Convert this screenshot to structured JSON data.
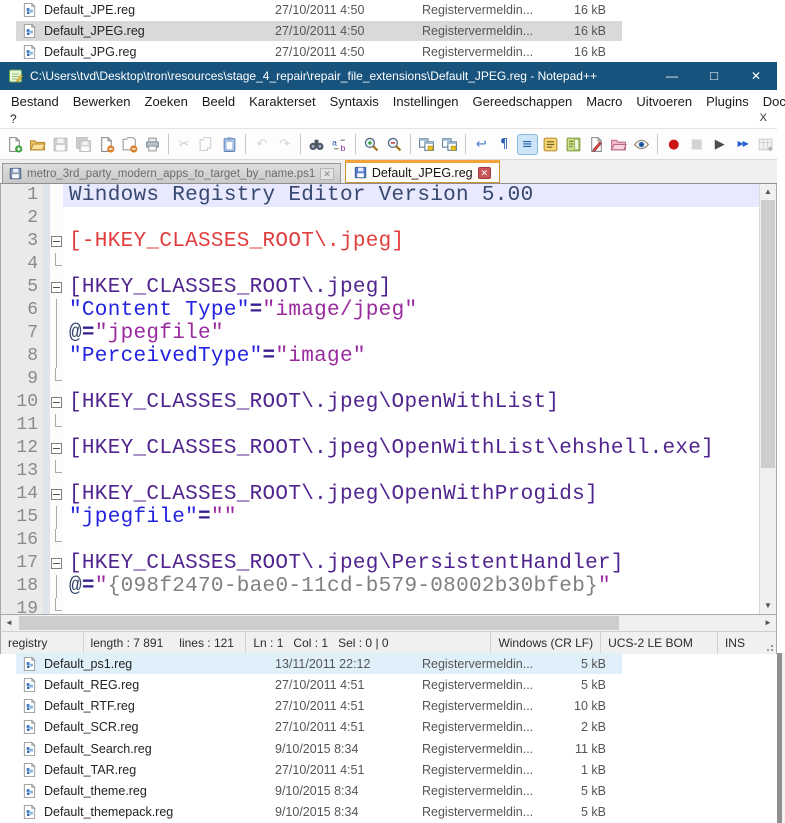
{
  "colors": {
    "titlebar": "#17537c",
    "tab_accent": "#f2a33c",
    "selection_gray": "#d9d9d9",
    "hover_blue": "#e0f0fa",
    "current_line": "#e8e8ff"
  },
  "explorer_top": {
    "rows": [
      {
        "name": "Default_JPE.reg",
        "date": "27/10/2011 4:50",
        "type": "Registervermeldin...",
        "size": "16 kB",
        "state": ""
      },
      {
        "name": "Default_JPEG.reg",
        "date": "27/10/2011 4:50",
        "type": "Registervermeldin...",
        "size": "16 kB",
        "state": "selected"
      },
      {
        "name": "Default_JPG.reg",
        "date": "27/10/2011 4:50",
        "type": "Registervermeldin...",
        "size": "16 kB",
        "state": ""
      }
    ]
  },
  "explorer_bottom": {
    "rows": [
      {
        "name": "Default_ps1.reg",
        "date": "13/11/2011 22:12",
        "type": "Registervermeldin...",
        "size": "5 kB",
        "state": "hover"
      },
      {
        "name": "Default_REG.reg",
        "date": "27/10/2011 4:51",
        "type": "Registervermeldin...",
        "size": "5 kB",
        "state": ""
      },
      {
        "name": "Default_RTF.reg",
        "date": "27/10/2011 4:51",
        "type": "Registervermeldin...",
        "size": "10 kB",
        "state": ""
      },
      {
        "name": "Default_SCR.reg",
        "date": "27/10/2011 4:51",
        "type": "Registervermeldin...",
        "size": "2 kB",
        "state": ""
      },
      {
        "name": "Default_Search.reg",
        "date": "9/10/2015 8:34",
        "type": "Registervermeldin...",
        "size": "11 kB",
        "state": ""
      },
      {
        "name": "Default_TAR.reg",
        "date": "27/10/2011 4:51",
        "type": "Registervermeldin...",
        "size": "1 kB",
        "state": ""
      },
      {
        "name": "Default_theme.reg",
        "date": "9/10/2015 8:34",
        "type": "Registervermeldin...",
        "size": "5 kB",
        "state": ""
      },
      {
        "name": "Default_themepack.reg",
        "date": "9/10/2015 8:34",
        "type": "Registervermeldin...",
        "size": "5 kB",
        "state": ""
      }
    ]
  },
  "npp": {
    "title": "C:\\Users\\tvd\\Desktop\\tron\\resources\\stage_4_repair\\repair_file_extensions\\Default_JPEG.reg - Notepad++",
    "window_controls": {
      "minimize": "—",
      "maximize": "□",
      "close": "✕"
    },
    "menus": [
      "Bestand",
      "Bewerken",
      "Zoeken",
      "Beeld",
      "Karakterset",
      "Syntaxis",
      "Instellingen",
      "Gereedschappen",
      "Macro",
      "Uitvoeren",
      "Plugins",
      "Documenten"
    ],
    "menu_overflow": "?",
    "menu_close_x": "X",
    "toolbar": [
      {
        "name": "new-file",
        "kind": "pagePlus"
      },
      {
        "name": "open-file",
        "kind": "folderOpen"
      },
      {
        "name": "save",
        "kind": "floppy",
        "disabled": true
      },
      {
        "name": "save-all",
        "kind": "floppy2",
        "disabled": true
      },
      {
        "name": "close",
        "kind": "pageMinus"
      },
      {
        "name": "close-all",
        "kind": "pagesMinus"
      },
      {
        "name": "print",
        "kind": "printer"
      },
      {
        "sep": true
      },
      {
        "name": "cut",
        "kind": "char",
        "glyph": "✂",
        "color": "#8a8a8a",
        "disabled": true
      },
      {
        "name": "copy",
        "kind": "pages",
        "disabled": true
      },
      {
        "name": "paste",
        "kind": "clipboard"
      },
      {
        "sep": true
      },
      {
        "name": "undo",
        "kind": "char",
        "glyph": "↶",
        "color": "#9a9a9a",
        "disabled": true
      },
      {
        "name": "redo",
        "kind": "char",
        "glyph": "↷",
        "color": "#9a9a9a",
        "disabled": true
      },
      {
        "sep": true
      },
      {
        "name": "find",
        "kind": "binoculars"
      },
      {
        "name": "replace",
        "kind": "replace",
        "glyph": "ab"
      },
      {
        "sep": true
      },
      {
        "name": "zoom-in",
        "kind": "magPlus"
      },
      {
        "name": "zoom-out",
        "kind": "magMinus"
      },
      {
        "sep": true
      },
      {
        "name": "sync-vertical-scroll",
        "kind": "winpair"
      },
      {
        "name": "sync-horizontal-scroll",
        "kind": "winpair"
      },
      {
        "sep": true
      },
      {
        "name": "word-wrap",
        "kind": "char",
        "glyph": "↩",
        "color": "#4a79c9"
      },
      {
        "name": "show-all-characters",
        "kind": "char",
        "glyph": "¶",
        "color": "#2a5db0"
      },
      {
        "name": "show-indent-guide",
        "kind": "char",
        "glyph": "≡",
        "color": "#2a5db0",
        "active": true
      },
      {
        "name": "function-list",
        "kind": "funclist"
      },
      {
        "name": "document-map",
        "kind": "docmap"
      },
      {
        "name": "document-switcher",
        "kind": "docswitch"
      },
      {
        "name": "folder-as-workspace",
        "kind": "folderPink"
      },
      {
        "name": "monitoring",
        "kind": "eye"
      },
      {
        "sep": true
      },
      {
        "name": "record-macro",
        "kind": "char",
        "glyph": "●",
        "color": "#cc1616"
      },
      {
        "name": "stop-macro",
        "kind": "char",
        "glyph": "■",
        "color": "#9a9a9a",
        "disabled": true
      },
      {
        "name": "play-macro",
        "kind": "char",
        "glyph": "▶",
        "color": "#4d4d4d"
      },
      {
        "name": "run-macro-multiple",
        "kind": "ffwd",
        "glyph": "▶▶",
        "color": "#2a5fd0"
      },
      {
        "name": "save-macro",
        "kind": "macrosave",
        "disabled": true
      }
    ],
    "tabs": [
      {
        "label": "metro_3rd_party_modern_apps_to_target_by_name.ps1",
        "close": "✕",
        "active": false
      },
      {
        "label": "Default_JPEG.reg",
        "close": "✕",
        "active": true
      }
    ],
    "editor": {
      "lines": [
        {
          "n": "1",
          "fold": "",
          "cur": true,
          "t": [
            [
              "Windows Registry Editor Version 5.00",
              "default"
            ]
          ]
        },
        {
          "n": "2",
          "fold": "",
          "t": []
        },
        {
          "n": "3",
          "fold": "h",
          "t": [
            [
              "[-HKEY_CLASSES_ROOT\\.jpeg]",
              "delsec"
            ]
          ]
        },
        {
          "n": "4",
          "fold": "t",
          "t": []
        },
        {
          "n": "5",
          "fold": "h",
          "t": [
            [
              "[HKEY_CLASSES_ROOT\\.jpeg]",
              "section"
            ]
          ]
        },
        {
          "n": "6",
          "fold": "m",
          "t": [
            [
              "\"Content Type\"",
              "key"
            ],
            [
              "=",
              "eq"
            ],
            [
              "\"image/jpeg\"",
              "val"
            ]
          ]
        },
        {
          "n": "7",
          "fold": "m",
          "t": [
            [
              "@",
              "default"
            ],
            [
              "=",
              "eq"
            ],
            [
              "\"jpegfile\"",
              "val"
            ]
          ]
        },
        {
          "n": "8",
          "fold": "m",
          "t": [
            [
              "\"PerceivedType\"",
              "key"
            ],
            [
              "=",
              "eq"
            ],
            [
              "\"image\"",
              "val"
            ]
          ]
        },
        {
          "n": "9",
          "fold": "t",
          "t": []
        },
        {
          "n": "10",
          "fold": "h",
          "t": [
            [
              "[HKEY_CLASSES_ROOT\\.jpeg\\OpenWithList]",
              "section"
            ]
          ]
        },
        {
          "n": "11",
          "fold": "t",
          "t": []
        },
        {
          "n": "12",
          "fold": "h",
          "t": [
            [
              "[HKEY_CLASSES_ROOT\\.jpeg\\OpenWithList\\ehshell.exe]",
              "section"
            ]
          ]
        },
        {
          "n": "13",
          "fold": "t",
          "t": []
        },
        {
          "n": "14",
          "fold": "h",
          "t": [
            [
              "[HKEY_CLASSES_ROOT\\.jpeg\\OpenWithProgids]",
              "section"
            ]
          ]
        },
        {
          "n": "15",
          "fold": "m",
          "t": [
            [
              "\"jpegfile\"",
              "key"
            ],
            [
              "=",
              "eq"
            ],
            [
              "\"\"",
              "val"
            ]
          ]
        },
        {
          "n": "16",
          "fold": "t",
          "t": []
        },
        {
          "n": "17",
          "fold": "h",
          "t": [
            [
              "[HKEY_CLASSES_ROOT\\.jpeg\\PersistentHandler]",
              "section"
            ]
          ]
        },
        {
          "n": "18",
          "fold": "m",
          "t": [
            [
              "@",
              "default"
            ],
            [
              "=",
              "eq"
            ],
            [
              "\"",
              "val"
            ],
            [
              "{098f2470-bae0-11cd-b579-08002b30bfeb}",
              "gray"
            ],
            [
              "\"",
              "val"
            ]
          ]
        },
        {
          "n": "19",
          "fold": "t",
          "t": []
        }
      ]
    },
    "scrollbar": {
      "up": "▲",
      "down": "▼",
      "left": "◄",
      "right": "►"
    },
    "statusbar": {
      "doctype": "registry",
      "length": "length : 7 891",
      "lines": "lines : 121",
      "position": "Ln : 1   Col : 1   Sel : 0 | 0",
      "eol": "Windows (CR LF)",
      "encoding": "UCS-2 LE BOM",
      "mode": "INS"
    }
  }
}
